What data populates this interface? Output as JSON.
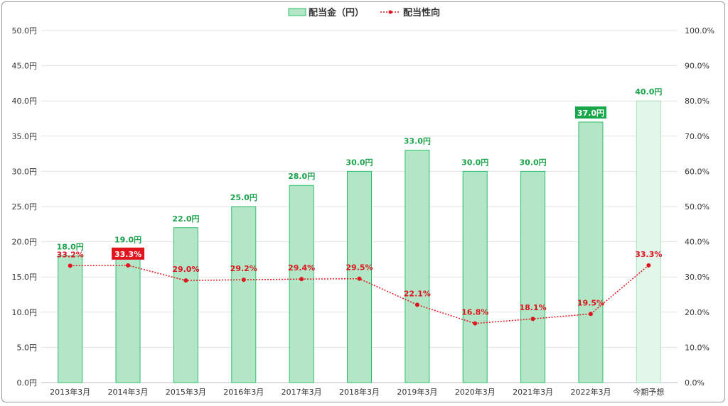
{
  "chart_data": {
    "type": "bar",
    "categories": [
      "2013年3月",
      "2014年3月",
      "2015年3月",
      "2016年3月",
      "2017年3月",
      "2018年3月",
      "2019年3月",
      "2020年3月",
      "2021年3月",
      "2022年3月",
      "今期予想"
    ],
    "series": [
      {
        "name": "配当金（円）",
        "type": "bar",
        "axis": "left",
        "values": [
          18.0,
          19.0,
          22.0,
          25.0,
          28.0,
          30.0,
          33.0,
          30.0,
          30.0,
          37.0,
          40.0
        ],
        "labels": [
          "18.0円",
          "19.0円",
          "22.0円",
          "25.0円",
          "28.0円",
          "30.0円",
          "33.0円",
          "30.0円",
          "30.0円",
          "37.0円",
          "40.0円"
        ],
        "highlight_index": 9,
        "forecast_index": 10
      },
      {
        "name": "配当性向",
        "type": "line",
        "axis": "right",
        "values": [
          33.2,
          33.3,
          29.0,
          29.2,
          29.4,
          29.5,
          22.1,
          16.8,
          18.1,
          19.5,
          33.3
        ],
        "labels": [
          "33.2%",
          "33.3%",
          "29.0%",
          "29.2%",
          "29.4%",
          "29.5%",
          "22.1%",
          "16.8%",
          "18.1%",
          "19.5%",
          "33.3%"
        ],
        "highlight_index": 1
      }
    ],
    "y_left": {
      "min": 0,
      "max": 50,
      "ticks": [
        "0.0円",
        "5.0円",
        "10.0円",
        "15.0円",
        "20.0円",
        "25.0円",
        "30.0円",
        "35.0円",
        "40.0円",
        "45.0円",
        "50.0円"
      ]
    },
    "y_right": {
      "min": 0,
      "max": 100,
      "ticks": [
        "0.0%",
        "10.0%",
        "20.0%",
        "30.0%",
        "40.0%",
        "50.0%",
        "60.0%",
        "70.0%",
        "80.0%",
        "90.0%",
        "100.0%"
      ]
    },
    "grid": true,
    "legend": "top-center"
  },
  "colors": {
    "bar_fill": "#b3e6c7",
    "bar_stroke": "#2dbd6a",
    "forecast_fill": "#e3f6ea",
    "forecast_stroke": "#a6dfbd",
    "bar_label": "#1aa34a",
    "highlight_bar_bg": "#18a84c",
    "line": "#e0141e",
    "highlight_line_bg": "#e0141e",
    "grid": "#e3e3e3"
  }
}
